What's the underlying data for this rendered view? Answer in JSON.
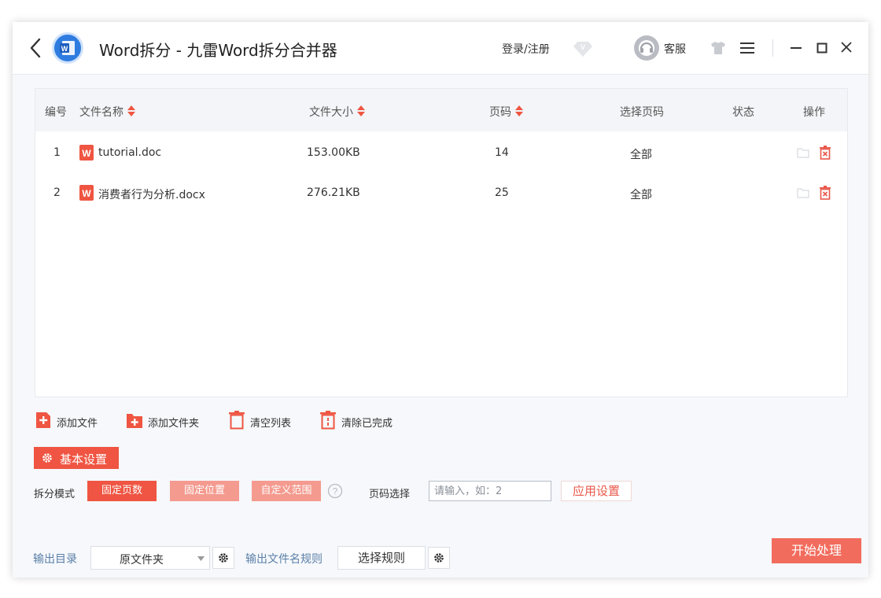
{
  "titlebar": {
    "title": "Word拆分 - 九雷Word拆分合并器",
    "login": "登录/注册",
    "customer_service": "客服"
  },
  "table": {
    "headers": {
      "index": "编号",
      "file_name": "文件名称",
      "file_size": "文件大小",
      "pages": "页码",
      "select_pages": "选择页码",
      "status": "状态",
      "action": "操作"
    },
    "rows": [
      {
        "index": "1",
        "file_name": "tutorial.doc",
        "file_size": "153.00KB",
        "pages": "14",
        "select_pages": "全部",
        "status": ""
      },
      {
        "index": "2",
        "file_name": "消费者行为分析.docx",
        "file_size": "276.21KB",
        "pages": "25",
        "select_pages": "全部",
        "status": ""
      }
    ]
  },
  "toolbar": {
    "add_file": "添加文件",
    "add_folder": "添加文件夹",
    "clear_list": "清空列表",
    "clear_done": "清除已完成"
  },
  "settings": {
    "basic_settings": "基本设置",
    "split_mode_label": "拆分模式",
    "modes": [
      "固定页数",
      "固定位置",
      "自定义范围"
    ],
    "active_mode": "固定页数",
    "page_select_label": "页码选择",
    "page_input_placeholder": "请输入，如：2",
    "page_input_value": "",
    "apply": "应用设置"
  },
  "footer": {
    "output_dir_label": "输出目录",
    "output_dir_value": "原文件夹",
    "filename_rule_label": "输出文件名规则",
    "choose_rule": "选择规则",
    "start": "开始处理"
  },
  "colors": {
    "accent": "#ef5542",
    "accent_light": "#f49a8f",
    "link_blue": "#5a7fa8",
    "logo_blue": "#2f7ce0"
  }
}
